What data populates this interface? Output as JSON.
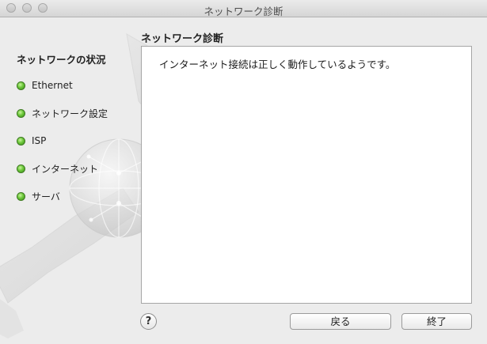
{
  "window": {
    "title": "ネットワーク診断"
  },
  "sidebar": {
    "title": "ネットワークの状況",
    "items": [
      {
        "label": "Ethernet",
        "status": "green"
      },
      {
        "label": "ネットワーク設定",
        "status": "green"
      },
      {
        "label": "ISP",
        "status": "green"
      },
      {
        "label": "インターネット",
        "status": "green"
      },
      {
        "label": "サーバ",
        "status": "green"
      }
    ]
  },
  "main": {
    "section_title": "ネットワーク診断",
    "result_text": "インターネット接続は正しく動作しているようです。"
  },
  "buttons": {
    "help": "?",
    "back": "戻る",
    "finish": "終了"
  },
  "colors": {
    "status_ok": "#6cc73a",
    "window_bg": "#ececec"
  }
}
